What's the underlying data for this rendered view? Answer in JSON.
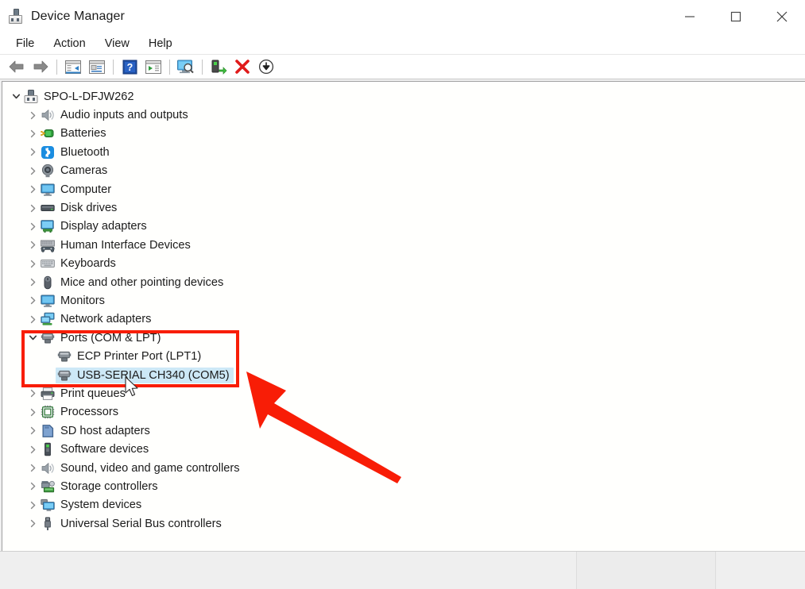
{
  "window": {
    "title": "Device Manager",
    "app_icon": "device-manager-icon",
    "controls": {
      "minimize": "Minimize",
      "maximize": "Maximize",
      "close": "Close"
    }
  },
  "menubar": {
    "items": [
      {
        "label": "File"
      },
      {
        "label": "Action"
      },
      {
        "label": "View"
      },
      {
        "label": "Help"
      }
    ]
  },
  "toolbar": {
    "buttons": [
      {
        "name": "back-button",
        "icon": "back-arrow-icon",
        "label": "Back"
      },
      {
        "name": "forward-button",
        "icon": "forward-arrow-icon",
        "label": "Forward"
      },
      {
        "name": "show-hide-console-tree-button",
        "icon": "console-tree-icon",
        "label": "Show/Hide Console Tree"
      },
      {
        "name": "properties-button",
        "icon": "properties-icon",
        "label": "Properties"
      },
      {
        "name": "help-button",
        "icon": "help-question-icon",
        "label": "Help"
      },
      {
        "name": "action-pane-button",
        "icon": "action-pane-icon",
        "label": "Show/Hide Action Pane"
      },
      {
        "name": "scan-hardware-changes-button",
        "icon": "scan-monitor-icon",
        "label": "Scan for hardware changes"
      },
      {
        "name": "update-driver-button",
        "icon": "update-driver-icon",
        "label": "Update driver"
      },
      {
        "name": "uninstall-device-button",
        "icon": "red-x-icon",
        "label": "Uninstall device"
      },
      {
        "name": "disable-device-button",
        "icon": "down-arrow-circle-icon",
        "label": "Disable device"
      }
    ]
  },
  "tree": {
    "root": {
      "label": "SPO-L-DFJW262",
      "icon": "computer-device-icon",
      "expanded": true,
      "chevron": "expanded"
    },
    "items": [
      {
        "label": "Audio inputs and outputs",
        "icon": "speaker-icon",
        "level": 1,
        "chevron": "collapsed",
        "selected": false
      },
      {
        "label": "Batteries",
        "icon": "battery-icon",
        "level": 1,
        "chevron": "collapsed",
        "selected": false
      },
      {
        "label": "Bluetooth",
        "icon": "bluetooth-icon",
        "level": 1,
        "chevron": "collapsed",
        "selected": false
      },
      {
        "label": "Cameras",
        "icon": "camera-icon",
        "level": 1,
        "chevron": "collapsed",
        "selected": false
      },
      {
        "label": "Computer",
        "icon": "monitor-icon",
        "level": 1,
        "chevron": "collapsed",
        "selected": false
      },
      {
        "label": "Disk drives",
        "icon": "disk-drive-icon",
        "level": 1,
        "chevron": "collapsed",
        "selected": false
      },
      {
        "label": "Display adapters",
        "icon": "display-adapter-icon",
        "level": 1,
        "chevron": "collapsed",
        "selected": false
      },
      {
        "label": "Human Interface Devices",
        "icon": "hid-gamepad-icon",
        "level": 1,
        "chevron": "collapsed",
        "selected": false
      },
      {
        "label": "Keyboards",
        "icon": "keyboard-icon",
        "level": 1,
        "chevron": "collapsed",
        "selected": false
      },
      {
        "label": "Mice and other pointing devices",
        "icon": "mouse-icon",
        "level": 1,
        "chevron": "collapsed",
        "selected": false
      },
      {
        "label": "Monitors",
        "icon": "monitor-icon",
        "level": 1,
        "chevron": "collapsed",
        "selected": false
      },
      {
        "label": "Network adapters",
        "icon": "network-adapter-icon",
        "level": 1,
        "chevron": "collapsed",
        "selected": false
      },
      {
        "label": "Ports (COM & LPT)",
        "icon": "port-connector-icon",
        "level": 1,
        "chevron": "expanded",
        "selected": false
      },
      {
        "label": "ECP Printer Port (LPT1)",
        "icon": "port-connector-icon",
        "level": 2,
        "chevron": "none",
        "selected": false
      },
      {
        "label": "USB-SERIAL CH340 (COM5)",
        "icon": "port-connector-icon",
        "level": 2,
        "chevron": "none",
        "selected": true
      },
      {
        "label": "Print queues",
        "icon": "printer-icon",
        "level": 1,
        "chevron": "collapsed",
        "selected": false
      },
      {
        "label": "Processors",
        "icon": "processor-icon",
        "level": 1,
        "chevron": "collapsed",
        "selected": false
      },
      {
        "label": "SD host adapters",
        "icon": "sd-card-icon",
        "level": 1,
        "chevron": "collapsed",
        "selected": false
      },
      {
        "label": "Software devices",
        "icon": "software-device-icon",
        "level": 1,
        "chevron": "collapsed",
        "selected": false
      },
      {
        "label": "Sound, video and game controllers",
        "icon": "speaker-icon",
        "level": 1,
        "chevron": "collapsed",
        "selected": false
      },
      {
        "label": "Storage controllers",
        "icon": "storage-controller-icon",
        "level": 1,
        "chevron": "collapsed",
        "selected": false
      },
      {
        "label": "System devices",
        "icon": "system-device-icon",
        "level": 1,
        "chevron": "collapsed",
        "selected": false
      },
      {
        "label": "Universal Serial Bus controllers",
        "icon": "usb-icon",
        "level": 1,
        "chevron": "collapsed",
        "selected": false
      }
    ]
  },
  "statusbar": {
    "cells": [
      "",
      "",
      ""
    ]
  },
  "annotations": {
    "highlight_rect": {
      "name": "ports-highlight-rectangle",
      "color": "#f81d06"
    },
    "arrow": {
      "name": "pointer-arrow-annotation",
      "color": "#f81d06"
    },
    "cursor": {
      "name": "mouse-cursor"
    }
  },
  "colors": {
    "annotation_red": "#f81d06",
    "selection_blue": "#cde8f6",
    "titlebar_bg": "#ffffff",
    "text": "#1b1b1b"
  }
}
